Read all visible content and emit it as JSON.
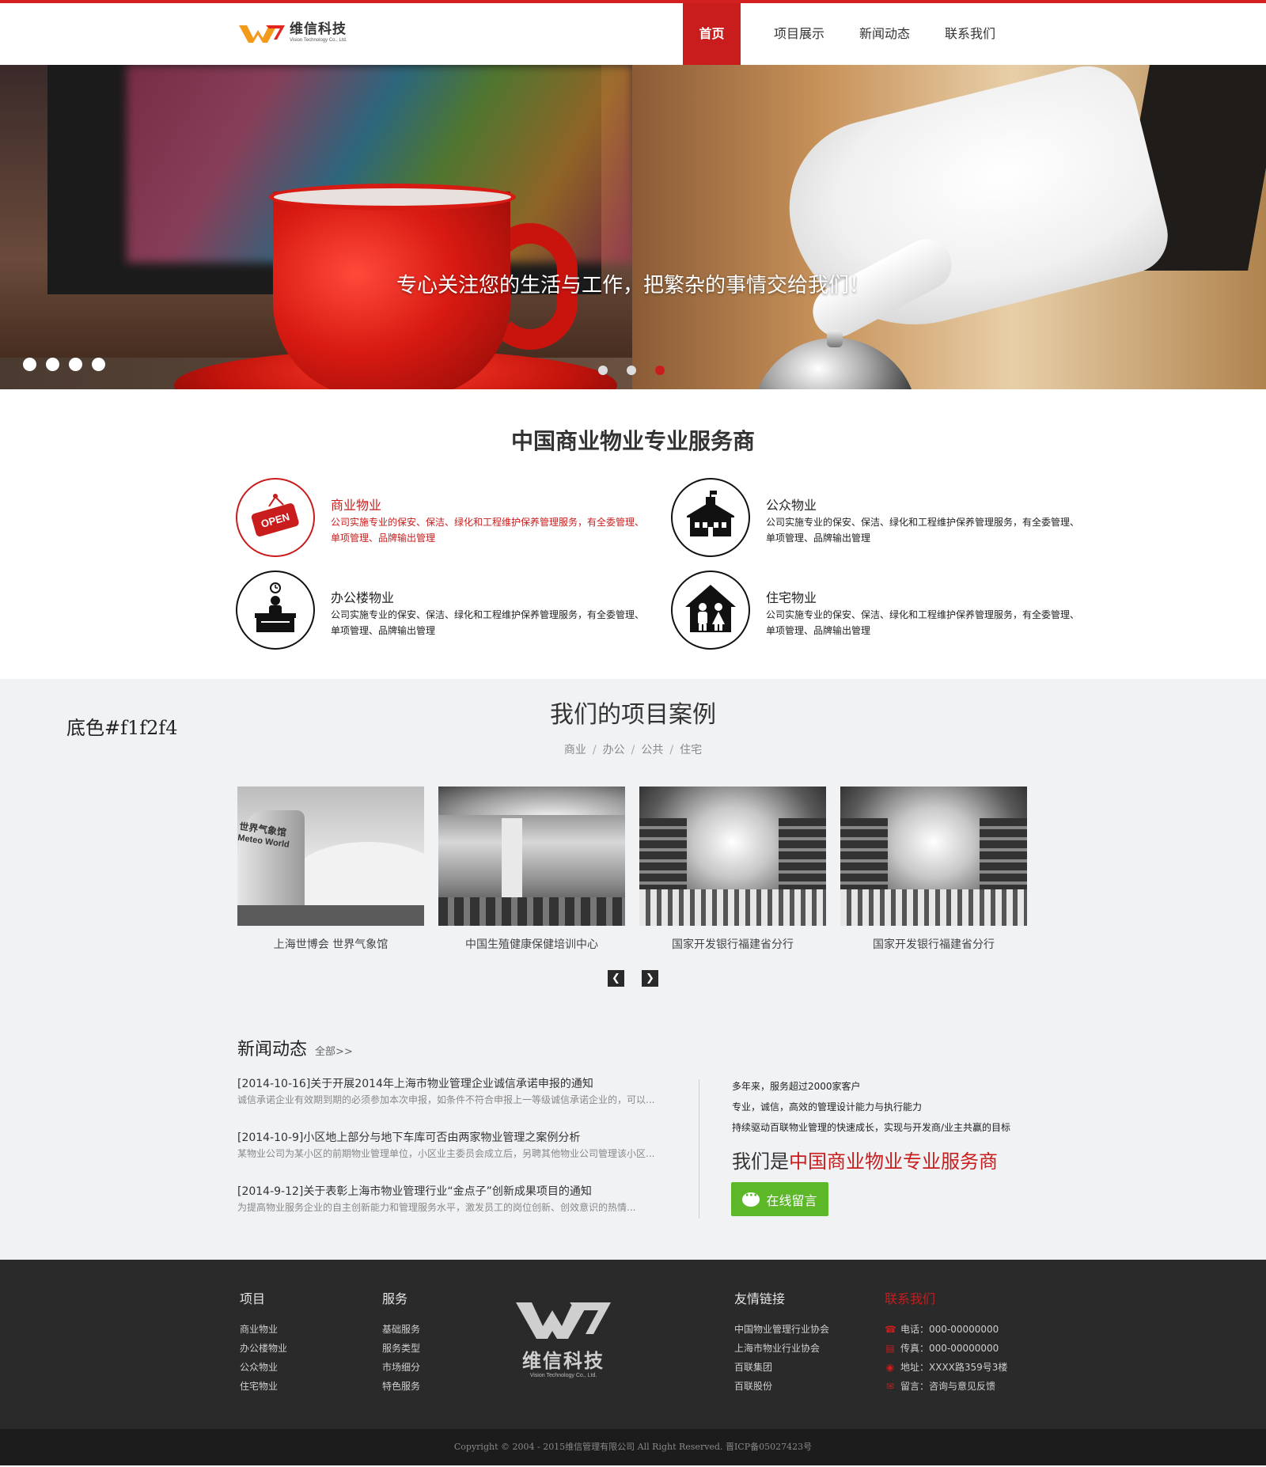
{
  "header": {
    "logo": {
      "cn": "维信科技",
      "en": "Vision Technology Co., Ltd."
    },
    "nav": [
      "首页",
      "项目展示",
      "新闻动态",
      "联系我们"
    ],
    "accent": "#c91c1c"
  },
  "banner": {
    "caption": "专心关注您的生活与工作，把繁杂的事情交给我们！",
    "slide_count": 3,
    "active_slide": 3
  },
  "services": {
    "title": "中国商业物业专业服务商",
    "items": [
      {
        "title": "商业物业",
        "desc": "公司实施专业的保安、保洁、绿化和工程维护保养管理服务，有全委管理、单项管理、品牌输出管理",
        "icon": "open-sign-icon",
        "icon_text": "OPEN"
      },
      {
        "title": "公众物业",
        "desc": "公司实施专业的保安、保洁、绿化和工程维护保养管理服务，有全委管理、单项管理、品牌输出管理",
        "icon": "school-building-icon"
      },
      {
        "title": "办公楼物业",
        "desc": "公司实施专业的保安、保洁、绿化和工程维护保养管理服务，有全委管理、单项管理、品牌输出管理",
        "icon": "office-desk-icon"
      },
      {
        "title": "住宅物业",
        "desc": "公司实施专业的保安、保洁、绿化和工程维护保养管理服务，有全委管理、单项管理、品牌输出管理",
        "icon": "family-house-icon"
      }
    ]
  },
  "projects": {
    "bg_note": "底色#f1f2f4",
    "title": "我们的项目案例",
    "filters": [
      "商业",
      "办公",
      "公共",
      "住宅"
    ],
    "filter_sep": "/",
    "items": [
      {
        "caption": "上海世博会  世界气象馆",
        "img_text": [
          "世界气象馆",
          "Meteo World"
        ]
      },
      {
        "caption": "中国生殖健康保健培训中心"
      },
      {
        "caption": "国家开发银行福建省分行"
      },
      {
        "caption": "国家开发银行福建省分行"
      }
    ]
  },
  "news": {
    "title": "新闻动态",
    "more": "全部>>",
    "items": [
      {
        "title": "[2014-10-16]关于开展2014年上海市物业管理企业诚信承诺申报的通知",
        "summary": "诚信承诺企业有效期到期的必须参加本次申报，如条件不符合申报上一等级诚信承诺企业的，可以..."
      },
      {
        "title": "[2014-10-9]小区地上部分与地下车库可否由两家物业管理之案例分析",
        "summary": "某物业公司为某小区的前期物业管理单位，小区业主委员会成立后，另聘其他物业公司管理该小区..."
      },
      {
        "title": "[2014-9-12]关于表彰上海市物业管理行业“金点子”创新成果项目的通知",
        "summary": "为提高物业服务企业的自主创新能力和管理服务水平，激发员工的岗位创新、创效意识的热情..."
      }
    ]
  },
  "about": {
    "lines": [
      "多年来，服务超过2000家客户",
      "专业，诚信，高效的管理设计能力与执行能力",
      "持续驱动百联物业管理的快速成长，实现与开发商/业主共赢的目标"
    ],
    "big_prefix": "我们是",
    "big_highlight": "中国商业物业专业服务商",
    "message_button": "在线留言",
    "button_color": "#5cb829"
  },
  "footer": {
    "project": {
      "title": "项目",
      "links": [
        "商业物业",
        "办公楼物业",
        "公众物业",
        "住宅物业"
      ]
    },
    "service": {
      "title": "服务",
      "links": [
        "基础服务",
        "服务类型",
        "市场细分",
        "特色服务"
      ]
    },
    "logo": {
      "cn": "维信科技",
      "en": "Vision Technology Co., Ltd."
    },
    "friends": {
      "title": "友情链接",
      "links": [
        "中国物业管理行业协会",
        "上海市物业行业协会",
        "百联集团",
        "百联股份"
      ]
    },
    "contact": {
      "title": "联系我们",
      "items": [
        {
          "icon": "phone-icon",
          "text": "电话：000-00000000"
        },
        {
          "icon": "fax-icon",
          "text": "传真：000-00000000"
        },
        {
          "icon": "location-pin-icon",
          "text": "地址：XXXX路359号3楼"
        },
        {
          "icon": "message-bubble-icon",
          "text": "留言：咨询与意见反馈"
        }
      ]
    },
    "copyright": "Copyright © 2004 - 2015维信管理有限公司  All Right Reserved.   晋ICP备05027423号"
  }
}
